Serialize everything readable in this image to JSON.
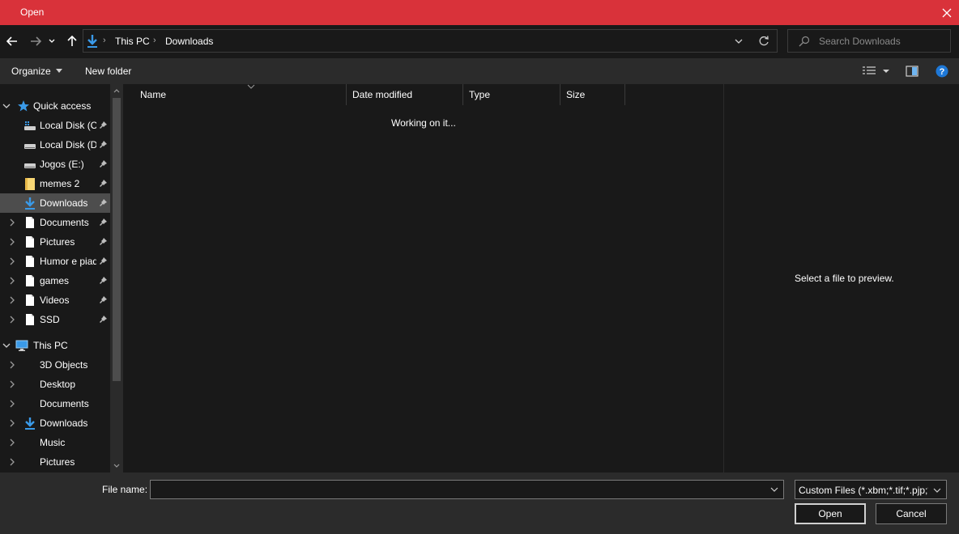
{
  "window": {
    "title": "Open",
    "accent": "#d9323a"
  },
  "address": {
    "crumbs": [
      "This PC",
      "Downloads"
    ]
  },
  "search": {
    "placeholder": "Search Downloads"
  },
  "toolbar": {
    "organize": "Organize",
    "new_folder": "New folder"
  },
  "quick_access": {
    "label": "Quick access",
    "items": [
      {
        "label": "Local Disk (C:)",
        "icon": "drive-c-icon",
        "pinned": true
      },
      {
        "label": "Local Disk (D:)",
        "icon": "drive-icon",
        "pinned": true
      },
      {
        "label": "Jogos (E:)",
        "icon": "drive-icon",
        "pinned": true
      },
      {
        "label": "memes 2",
        "icon": "folder-icon",
        "pinned": true
      },
      {
        "label": "Downloads",
        "icon": "download-icon",
        "pinned": true,
        "selected": true
      },
      {
        "label": "Documents",
        "icon": "document-icon",
        "pinned": true
      },
      {
        "label": "Pictures",
        "icon": "document-icon",
        "pinned": true
      },
      {
        "label": "Humor e piadas",
        "icon": "document-icon",
        "pinned": true
      },
      {
        "label": "games",
        "icon": "document-icon",
        "pinned": true
      },
      {
        "label": "Videos",
        "icon": "document-icon",
        "pinned": true
      },
      {
        "label": "SSD",
        "icon": "document-icon",
        "pinned": true
      }
    ]
  },
  "this_pc": {
    "label": "This PC",
    "items": [
      {
        "label": "3D Objects"
      },
      {
        "label": "Desktop"
      },
      {
        "label": "Documents"
      },
      {
        "label": "Downloads",
        "icon": "download-icon"
      },
      {
        "label": "Music"
      },
      {
        "label": "Pictures"
      }
    ]
  },
  "columns": [
    "Name",
    "Date modified",
    "Type",
    "Size"
  ],
  "status": "Working on it...",
  "preview": "Select a file to preview.",
  "footer": {
    "file_name_label": "File name:",
    "file_name_value": "",
    "filter": "Custom Files (*.xbm;*.tif;*.pjp;*.svgz;*.jpg;*.jpeg;*.ico;*.tiff;*.gif;*.svg;*.jfif;*.webp;*.png;*.bmp;*.pjpeg;*.avif)",
    "open": "Open",
    "cancel": "Cancel"
  }
}
